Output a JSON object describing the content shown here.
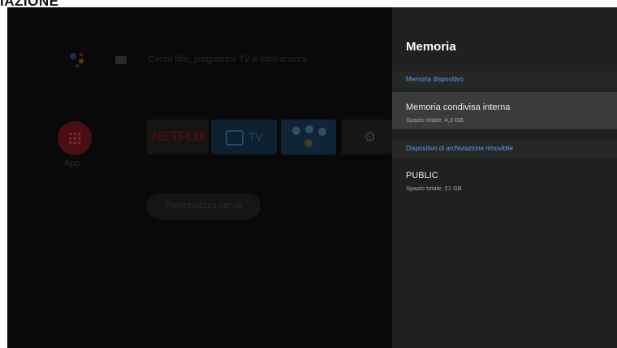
{
  "page_heading": "IAZIONE",
  "launcher": {
    "search_placeholder": "Cerca film, programmi TV e altro ancora",
    "apps_label": "App",
    "netflix_label": "NETFLIX",
    "tv_label": "TV",
    "customize_button": "Personalizza canali"
  },
  "panel": {
    "title": "Memoria",
    "sections": [
      {
        "header": "Memoria dispositivo",
        "items": [
          {
            "label": "Memoria condivisa interna",
            "sub": "Spazio totale: 4,3 GB",
            "focused": true
          }
        ]
      },
      {
        "header": "Dispositivo di archiviazione rimovibile",
        "items": [
          {
            "label": "PUBLIC",
            "sub": "Spazio totale: 21 GB",
            "focused": false
          }
        ]
      }
    ]
  },
  "colors": {
    "panel_bg": "#1f2121",
    "focused_bg": "#3a3c3c",
    "section_text": "#5d9cec"
  },
  "icons": [
    "google-assistant-icon",
    "keyboard-icon",
    "apps-grid-icon",
    "tv-icon",
    "settings-gear-icon"
  ]
}
